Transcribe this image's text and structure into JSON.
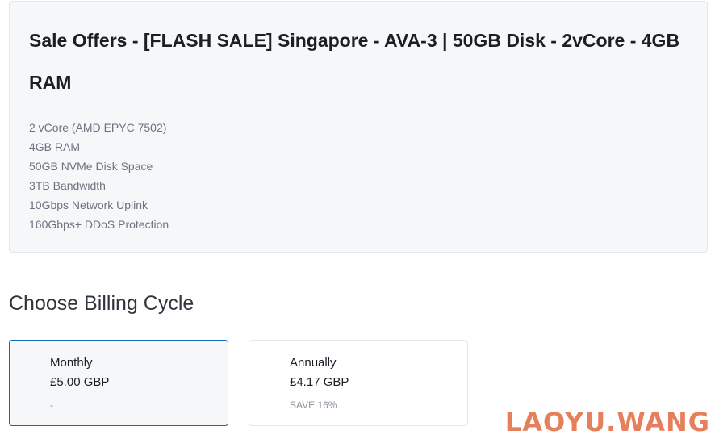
{
  "product": {
    "title": "Sale Offers - [FLASH SALE] Singapore - AVA-3 | 50GB Disk - 2vCore - 4GB RAM",
    "features": [
      "2 vCore (AMD EPYC 7502)",
      "4GB RAM",
      "50GB NVMe Disk Space",
      "3TB Bandwidth",
      "10Gbps Network Uplink",
      "160Gbps+ DDoS Protection"
    ]
  },
  "billing": {
    "heading": "Choose Billing Cycle",
    "options": [
      {
        "name": "Monthly",
        "price": "£5.00 GBP",
        "note": "-",
        "selected": true
      },
      {
        "name": "Annually",
        "price": "£4.17 GBP",
        "note": "SAVE 16%",
        "selected": false
      }
    ]
  },
  "watermark": "LAOYU.WANG",
  "colors": {
    "panel_bg": "#f6f7f9",
    "selected_border": "#1565c0",
    "watermark": "#e26a40"
  }
}
